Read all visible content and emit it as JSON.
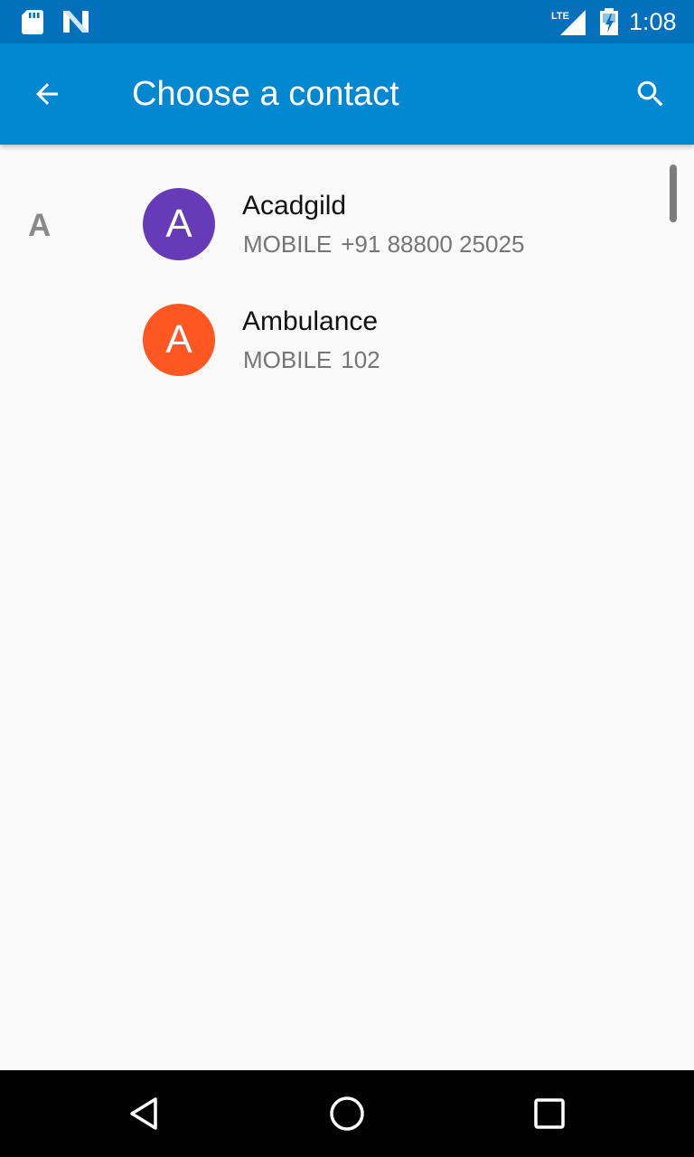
{
  "status_bar": {
    "network": "LTE",
    "time": "1:08",
    "icons": [
      "sd-card-icon",
      "n-notification-icon",
      "lte-signal-icon",
      "battery-charging-icon"
    ]
  },
  "app_bar": {
    "title": "Choose a contact",
    "back_icon": "arrow-back-icon",
    "search_icon": "search-icon",
    "color": "#0288d1",
    "status_color": "#0270bb"
  },
  "contacts": {
    "section_letter": "A",
    "items": [
      {
        "initial": "A",
        "name": "Acadgild",
        "phone_type": "MOBILE",
        "phone": "+91 88800 25025",
        "avatar_color": "#673ab7"
      },
      {
        "initial": "A",
        "name": "Ambulance",
        "phone_type": "MOBILE",
        "phone": "102",
        "avatar_color": "#ff5722"
      }
    ]
  },
  "nav_bar": {
    "icons": [
      "back-triangle-icon",
      "home-circle-icon",
      "recents-square-icon"
    ]
  }
}
